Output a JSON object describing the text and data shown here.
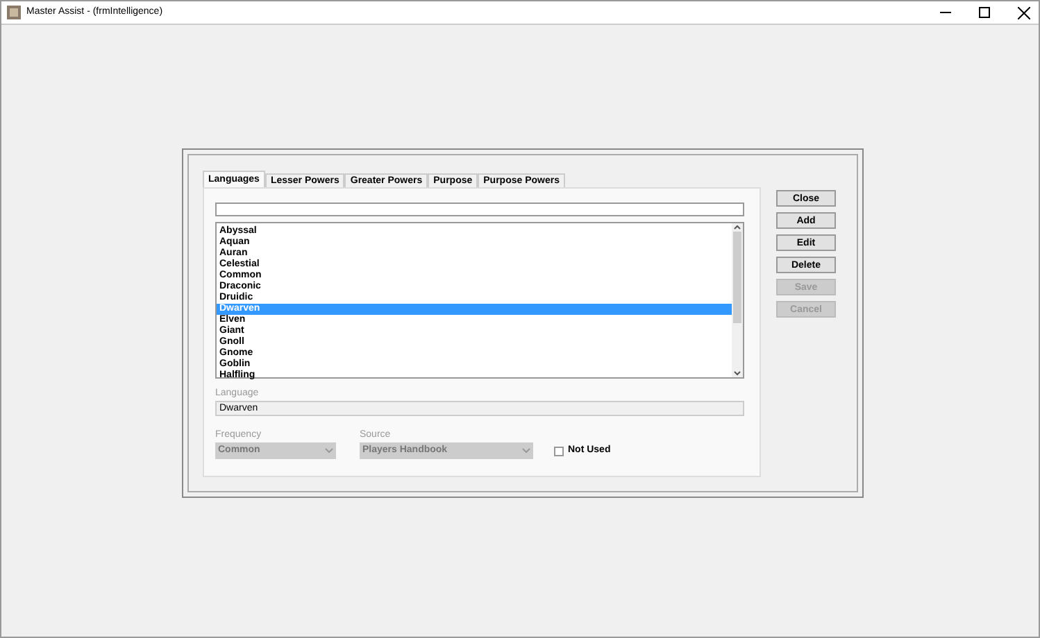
{
  "window": {
    "title": "Master Assist - (frmIntelligence)"
  },
  "tabs": [
    {
      "label": "Languages",
      "selected": true
    },
    {
      "label": "Lesser Powers",
      "selected": false
    },
    {
      "label": "Greater Powers",
      "selected": false
    },
    {
      "label": "Purpose",
      "selected": false
    },
    {
      "label": "Purpose Powers",
      "selected": false
    }
  ],
  "languages": [
    {
      "label": "Abyssal",
      "selected": false
    },
    {
      "label": "Aquan",
      "selected": false
    },
    {
      "label": "Auran",
      "selected": false
    },
    {
      "label": "Celestial",
      "selected": false
    },
    {
      "label": "Common",
      "selected": false
    },
    {
      "label": "Draconic",
      "selected": false
    },
    {
      "label": "Druidic",
      "selected": false
    },
    {
      "label": "Dwarven",
      "selected": true
    },
    {
      "label": "Elven",
      "selected": false
    },
    {
      "label": "Giant",
      "selected": false
    },
    {
      "label": "Gnoll",
      "selected": false
    },
    {
      "label": "Gnome",
      "selected": false
    },
    {
      "label": "Goblin",
      "selected": false
    },
    {
      "label": "Halfling",
      "selected": false
    }
  ],
  "language": {
    "label": "Language",
    "value": "Dwarven"
  },
  "frequency": {
    "label": "Frequency",
    "value": "Common"
  },
  "source": {
    "label": "Source",
    "value": "Players Handbook"
  },
  "not_used": {
    "label": "Not Used",
    "checked": false
  },
  "buttons": [
    {
      "label": "Close",
      "disabled": false
    },
    {
      "label": "Add",
      "disabled": false
    },
    {
      "label": "Edit",
      "disabled": false
    },
    {
      "label": "Delete",
      "disabled": false
    },
    {
      "label": "Save",
      "disabled": true
    },
    {
      "label": "Cancel",
      "disabled": true
    }
  ]
}
